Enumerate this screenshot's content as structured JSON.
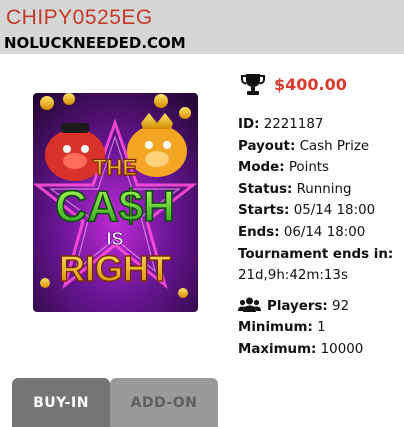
{
  "header": {
    "code": "CHIPY0525EG",
    "site": "NOLUCKNEEDED.COM"
  },
  "game": {
    "image_title_lines": [
      "THE",
      "CA$H",
      "IS",
      "RIGHT"
    ]
  },
  "prize": {
    "icon": "trophy-icon",
    "amount": "$400.00",
    "color": "#d83a2a"
  },
  "details": {
    "id_label": "ID:",
    "id_value": "2221187",
    "payout_label": "Payout:",
    "payout_value": "Cash Prize",
    "mode_label": "Mode:",
    "mode_value": "Points",
    "status_label": "Status:",
    "status_value": "Running",
    "starts_label": "Starts:",
    "starts_value": "05/14 18:00",
    "ends_label": "Ends:",
    "ends_value": "06/14 18:00",
    "tournament_ends_label": "Tournament ends in:",
    "tournament_ends_value": "21d,9h:42m:13s"
  },
  "players": {
    "icon": "users-icon",
    "players_label": "Players:",
    "players_value": "92",
    "minimum_label": "Minimum:",
    "minimum_value": "1",
    "maximum_label": "Maximum:",
    "maximum_value": "10000"
  },
  "tabs": {
    "buy_in": "BUY-IN",
    "add_on": "ADD-ON",
    "active": "BUY-IN"
  }
}
